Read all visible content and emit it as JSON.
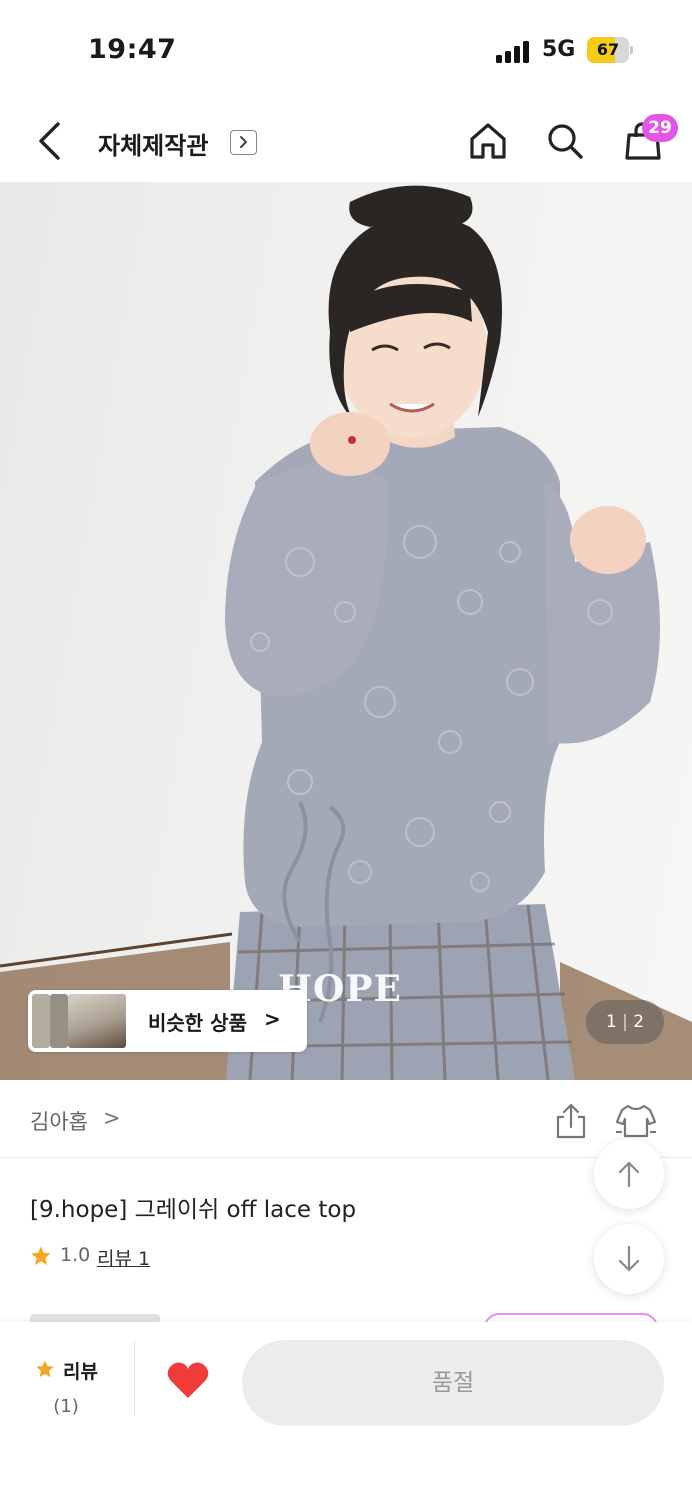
{
  "status_bar": {
    "time": "19:47",
    "network": "5G",
    "battery": "67",
    "battery_level": 0.67
  },
  "header": {
    "shop_title": "자체제작관",
    "cart_count": "29"
  },
  "hero": {
    "watermark": "HOPE",
    "similar_products_label": "비슷한 상품",
    "similar_chevron": ">",
    "page_current": "1",
    "page_total": "2",
    "page_separator": "|"
  },
  "brand": {
    "name": "김아홉",
    "chevron": ">"
  },
  "product": {
    "title": "[9.hope] 그레이쉬 off lace top",
    "rating": "1.0",
    "review_link": "리뷰 1"
  },
  "bottom_bar": {
    "review_label": "리뷰",
    "review_count": "(1)",
    "soldout_label": "품절"
  },
  "colors": {
    "accent_badge": "#e356e5",
    "star": "#f5a623",
    "heart": "#f03b3b",
    "battery_fill": "#f5cc15",
    "soldout_bg": "#ececec"
  }
}
